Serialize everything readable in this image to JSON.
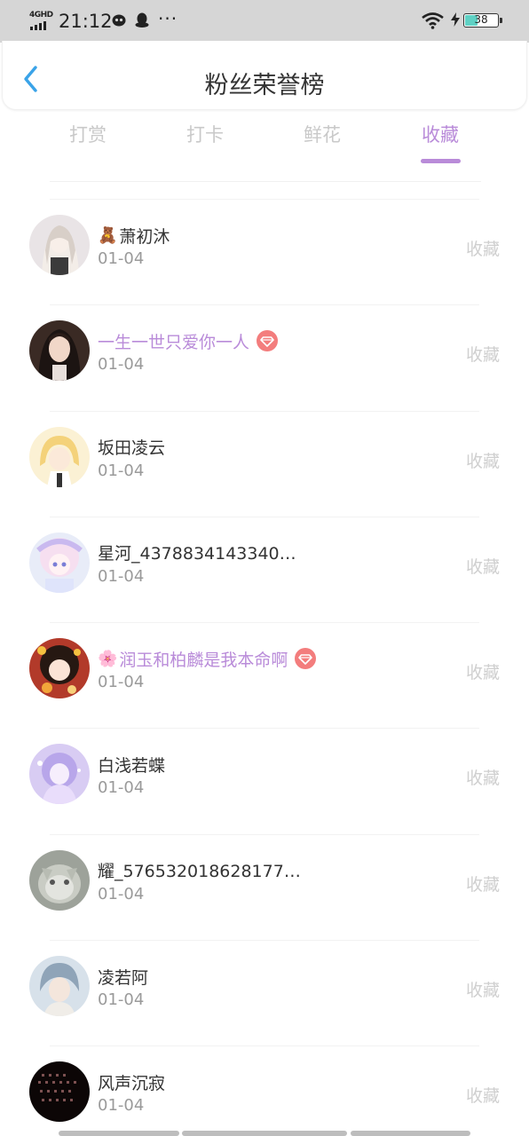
{
  "status_bar": {
    "network": "4GHD",
    "time": "21:12",
    "more": "···",
    "battery": "38",
    "battery_level": 0.38
  },
  "header": {
    "title": "粉丝荣誉榜",
    "back_icon": "chevron-left-icon"
  },
  "tabs": [
    {
      "label": "打赏",
      "active": false
    },
    {
      "label": "打卡",
      "active": false
    },
    {
      "label": "鲜花",
      "active": false
    },
    {
      "label": "收藏",
      "active": true
    }
  ],
  "colors": {
    "accent": "#b98bd9",
    "badge": "#f37d7d",
    "muted": "#9a9a9a"
  },
  "fans": [
    {
      "prefix": "🧸",
      "name": "萧初沐",
      "date": "01-04",
      "action": "收藏",
      "vip": false,
      "badge": false
    },
    {
      "prefix": "",
      "name": "一生一世只爱你一人",
      "date": "01-04",
      "action": "收藏",
      "vip": true,
      "badge": true
    },
    {
      "prefix": "",
      "name": "坂田凌云",
      "date": "01-04",
      "action": "收藏",
      "vip": false,
      "badge": false
    },
    {
      "prefix": "",
      "name": "星河_4378834143340…",
      "date": "01-04",
      "action": "收藏",
      "vip": false,
      "badge": false
    },
    {
      "prefix": "🌸",
      "name": "润玉和柏麟是我本命啊",
      "date": "01-04",
      "action": "收藏",
      "vip": true,
      "badge": true
    },
    {
      "prefix": "",
      "name": "白浅若蝶",
      "date": "01-04",
      "action": "收藏",
      "vip": false,
      "badge": false
    },
    {
      "prefix": "",
      "name": "耀_576532018628177…",
      "date": "01-04",
      "action": "收藏",
      "vip": false,
      "badge": false
    },
    {
      "prefix": "",
      "name": "凌若阿",
      "date": "01-04",
      "action": "收藏",
      "vip": false,
      "badge": false
    },
    {
      "prefix": "",
      "name": "风声沉寂",
      "date": "01-04",
      "action": "收藏",
      "vip": false,
      "badge": false
    }
  ]
}
